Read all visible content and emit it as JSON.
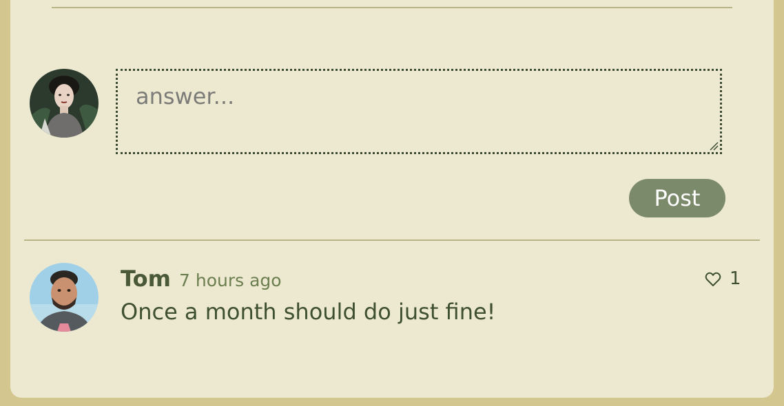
{
  "compose": {
    "placeholder": "answer...",
    "post_label": "Post"
  },
  "comments": [
    {
      "author": "Tom",
      "time": "7 hours ago",
      "text": "Once a month should do just fine!",
      "likes": "1"
    }
  ],
  "icons": {
    "like": "heart-outline-icon",
    "resize": "resize-handle-icon"
  },
  "colors": {
    "page_background": "#d3c78f",
    "card_background": "#ede9d1",
    "post_button": "#7b8a6a",
    "text_dark_green": "#3e5030",
    "timestamp": "#6b7e4f",
    "placeholder": "#7b7c78"
  }
}
